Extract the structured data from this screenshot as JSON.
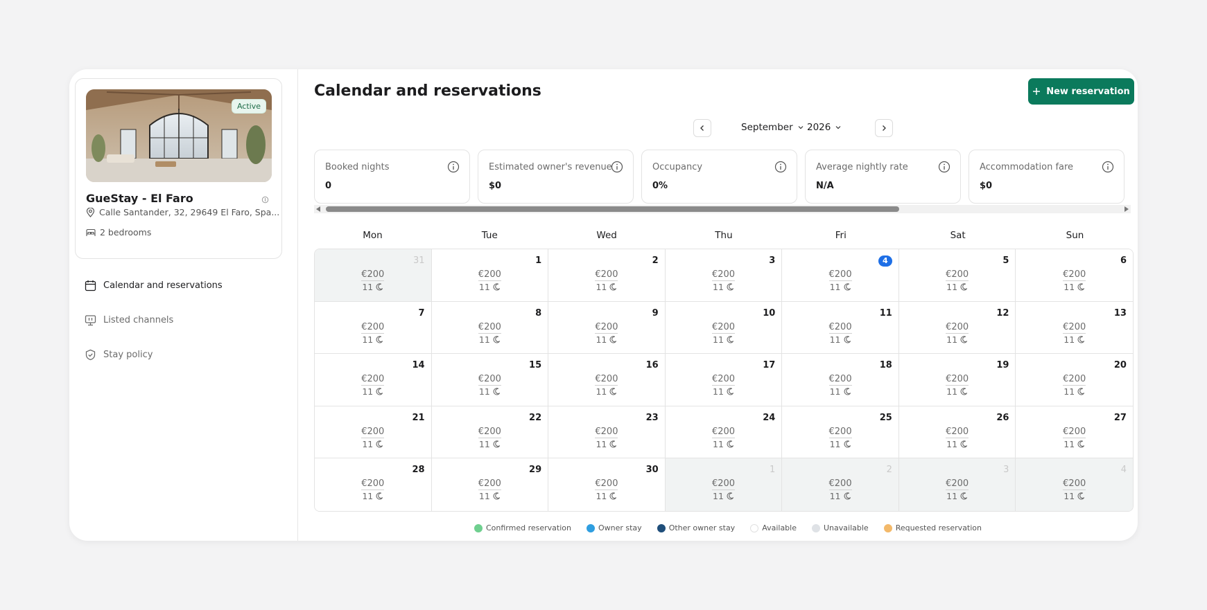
{
  "property": {
    "name": "GueStay - El Faro",
    "status": "Active",
    "address": "Calle Santander, 32, 29649 El Faro, Spa...",
    "bedrooms": "2 bedrooms"
  },
  "sidebar": {
    "items": [
      {
        "label": "Calendar and reservations",
        "icon": "calendar-icon",
        "active": true
      },
      {
        "label": "Listed channels",
        "icon": "channels-icon",
        "active": false
      },
      {
        "label": "Stay policy",
        "icon": "shield-check-icon",
        "active": false
      }
    ]
  },
  "header": {
    "title": "Calendar and reservations",
    "new_reservation_label": "New reservation",
    "month": "September",
    "year": "2026"
  },
  "stats": [
    {
      "label": "Booked nights",
      "value": "0"
    },
    {
      "label": "Estimated owner's revenue",
      "value": "$0"
    },
    {
      "label": "Occupancy",
      "value": "0%"
    },
    {
      "label": "Average nightly rate",
      "value": "N/A"
    },
    {
      "label": "Accommodation fare",
      "value": "$0"
    }
  ],
  "weekdays": [
    "Mon",
    "Tue",
    "Wed",
    "Thu",
    "Fri",
    "Sat",
    "Sun"
  ],
  "calendar": {
    "days": [
      {
        "day": "31",
        "out": true
      },
      {
        "day": "1"
      },
      {
        "day": "2"
      },
      {
        "day": "3"
      },
      {
        "day": "4",
        "today": true
      },
      {
        "day": "5"
      },
      {
        "day": "6"
      },
      {
        "day": "7"
      },
      {
        "day": "8"
      },
      {
        "day": "9"
      },
      {
        "day": "10"
      },
      {
        "day": "11"
      },
      {
        "day": "12"
      },
      {
        "day": "13"
      },
      {
        "day": "14"
      },
      {
        "day": "15"
      },
      {
        "day": "16"
      },
      {
        "day": "17"
      },
      {
        "day": "18"
      },
      {
        "day": "19"
      },
      {
        "day": "20"
      },
      {
        "day": "21"
      },
      {
        "day": "22"
      },
      {
        "day": "23"
      },
      {
        "day": "24"
      },
      {
        "day": "25"
      },
      {
        "day": "26"
      },
      {
        "day": "27"
      },
      {
        "day": "28"
      },
      {
        "day": "29"
      },
      {
        "day": "30"
      },
      {
        "day": "1",
        "out": true
      },
      {
        "day": "2",
        "out": true
      },
      {
        "day": "3",
        "out": true
      },
      {
        "day": "4",
        "out": true
      }
    ],
    "price": "€200",
    "nights": "11"
  },
  "legend": [
    {
      "label": "Confirmed reservation",
      "color": "#6fcf8f"
    },
    {
      "label": "Owner stay",
      "color": "#2f9ee0"
    },
    {
      "label": "Other owner stay",
      "color": "#1f4e7a"
    },
    {
      "label": "Available",
      "color": "#ffffff"
    },
    {
      "label": "Unavailable",
      "color": "#dfe2e6"
    },
    {
      "label": "Requested reservation",
      "color": "#f3b96a"
    }
  ],
  "colors": {
    "accent": "#0b7a5c",
    "today": "#1e6fe6"
  }
}
